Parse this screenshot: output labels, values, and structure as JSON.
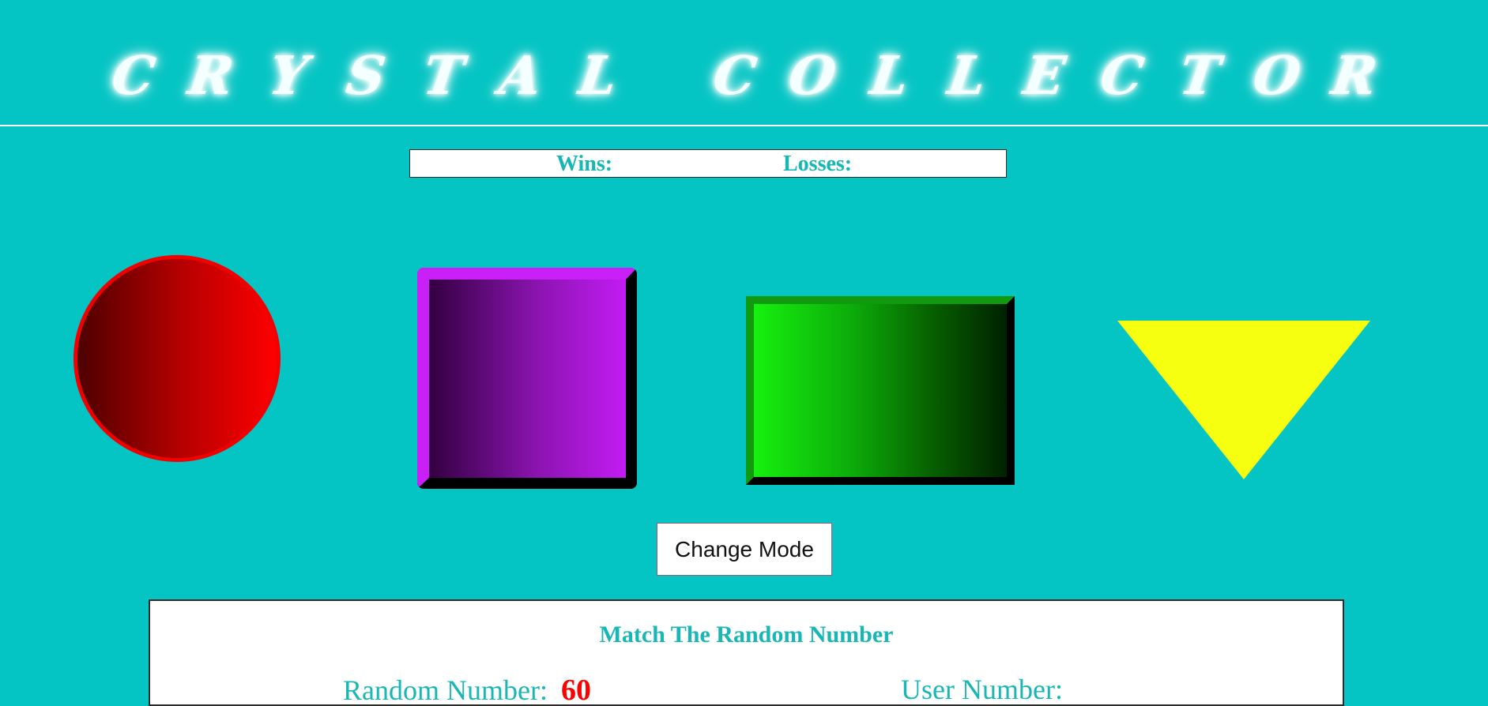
{
  "header": {
    "title_letters": [
      "C",
      "R",
      "Y",
      "S",
      "T",
      "A",
      "L",
      "",
      "C",
      "O",
      "L",
      "L",
      "E",
      "C",
      "T",
      "O",
      "R"
    ]
  },
  "scoreboard": {
    "wins_label": "Wins:",
    "losses_label": "Losses:"
  },
  "crystals": [
    {
      "name": "red-circle-crystal",
      "shape": "circle",
      "color_primary": "#ff0000",
      "color_dark": "#4d0000"
    },
    {
      "name": "purple-square-crystal",
      "shape": "square",
      "color_primary": "#c21cf3",
      "color_dark": "#330041"
    },
    {
      "name": "green-rectangle-crystal",
      "shape": "rectangle",
      "color_primary": "#16f10e",
      "color_dark": "#002100"
    },
    {
      "name": "yellow-triangle-crystal",
      "shape": "triangle",
      "color_primary": "#f7ff10"
    }
  ],
  "controls": {
    "change_mode_label": "Change Mode"
  },
  "game_panel": {
    "title": "Match The Random Number",
    "random_number_label": "Random Number:",
    "random_number_value": "60",
    "user_number_label": "User Number:"
  },
  "colors": {
    "background": "#05c5c4",
    "accent_text": "#16b7b4",
    "random_number": "#ff0000",
    "panel_background": "#ffffff"
  }
}
